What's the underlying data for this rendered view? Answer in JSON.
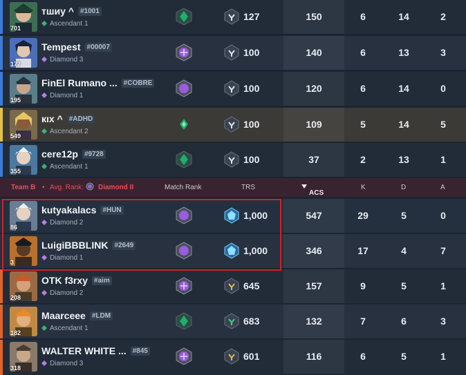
{
  "colors": {
    "team_a_accent": "#3d7bd9",
    "team_b_accent": "#e0642a",
    "team_b_yellow_accent": "#e0c14a",
    "highlight_border": "#d42020",
    "team_b_header_text": "#ea4b5c"
  },
  "team_b_header": {
    "team": "Team B",
    "separator": "•",
    "avg_rank_label": "Avg. Rank:",
    "avg_rank_icon": "diamond-rank-icon",
    "avg_rank_value": "Diamond II",
    "col_match_rank": "Match Rank",
    "col_trs": "TRS",
    "col_acs": "ACS",
    "col_k": "K",
    "col_d": "D",
    "col_a": "A"
  },
  "team_a": [
    {
      "name": "тшиу ^",
      "tag": "#1001",
      "rank": "Ascendant 1",
      "level": "701",
      "match_rank_icon": "ascendant-rank-icon",
      "trs_icon": "radiant-tier-icon",
      "trs": "127",
      "acs": "150",
      "k": "6",
      "d": "14",
      "a": "2"
    },
    {
      "name": "Tempest",
      "tag": "#00007",
      "rank": "Diamond 3",
      "level": "177",
      "match_rank_icon": "diamond-rank-icon",
      "trs_icon": "radiant-tier-icon",
      "trs": "100",
      "acs": "140",
      "k": "6",
      "d": "13",
      "a": "3"
    },
    {
      "name": "FinEl Rumano ...",
      "tag": "#COBRE",
      "rank": "Diamond 1",
      "level": "195",
      "match_rank_icon": "diamond-rank-icon",
      "trs_icon": "radiant-tier-icon",
      "trs": "100",
      "acs": "120",
      "k": "6",
      "d": "14",
      "a": "0"
    },
    {
      "name": "кıх ^",
      "tag": "#ADHD",
      "rank": "Ascendant 2",
      "level": "549",
      "match_rank_icon": "ascendant-rank-icon",
      "trs_icon": "radiant-tier-icon",
      "trs": "100",
      "acs": "109",
      "k": "5",
      "d": "14",
      "a": "5"
    },
    {
      "name": "cere12p",
      "tag": "#9728",
      "rank": "Ascendant 1",
      "level": "355",
      "match_rank_icon": "ascendant-rank-icon",
      "trs_icon": "radiant-tier-icon",
      "trs": "100",
      "acs": "37",
      "k": "2",
      "d": "13",
      "a": "1"
    }
  ],
  "team_b": [
    {
      "name": "kutyakalacs",
      "tag": "#HUN",
      "rank": "Diamond 2",
      "level": "86",
      "match_rank_icon": "diamond-rank-icon",
      "trs_icon": "diamond-tier-icon",
      "trs": "1,000",
      "acs": "547",
      "k": "29",
      "d": "5",
      "a": "0"
    },
    {
      "name": "LuigiBBBLINK",
      "tag": "#2649",
      "rank": "Diamond 1",
      "level": "3",
      "match_rank_icon": "diamond-rank-icon",
      "trs_icon": "diamond-tier-icon",
      "trs": "1,000",
      "acs": "346",
      "k": "17",
      "d": "4",
      "a": "7"
    },
    {
      "name": "OTK f3rxy",
      "tag": "#aim",
      "rank": "Diamond 2",
      "level": "208",
      "match_rank_icon": "diamond-rank-icon",
      "trs_icon": "gold-tier-icon",
      "trs": "645",
      "acs": "157",
      "k": "9",
      "d": "5",
      "a": "1"
    },
    {
      "name": "Maarceee",
      "tag": "#LDM",
      "rank": "Ascendant 1",
      "level": "182",
      "match_rank_icon": "ascendant-rank-icon",
      "trs_icon": "emerald-tier-icon",
      "trs": "683",
      "acs": "132",
      "k": "7",
      "d": "6",
      "a": "3"
    },
    {
      "name": "WALTER WHITE ...",
      "tag": "#845",
      "rank": "Diamond 3",
      "level": "318",
      "match_rank_icon": "diamond-rank-icon",
      "trs_icon": "gold-tier-icon",
      "trs": "601",
      "acs": "116",
      "k": "6",
      "d": "5",
      "a": "1"
    }
  ]
}
